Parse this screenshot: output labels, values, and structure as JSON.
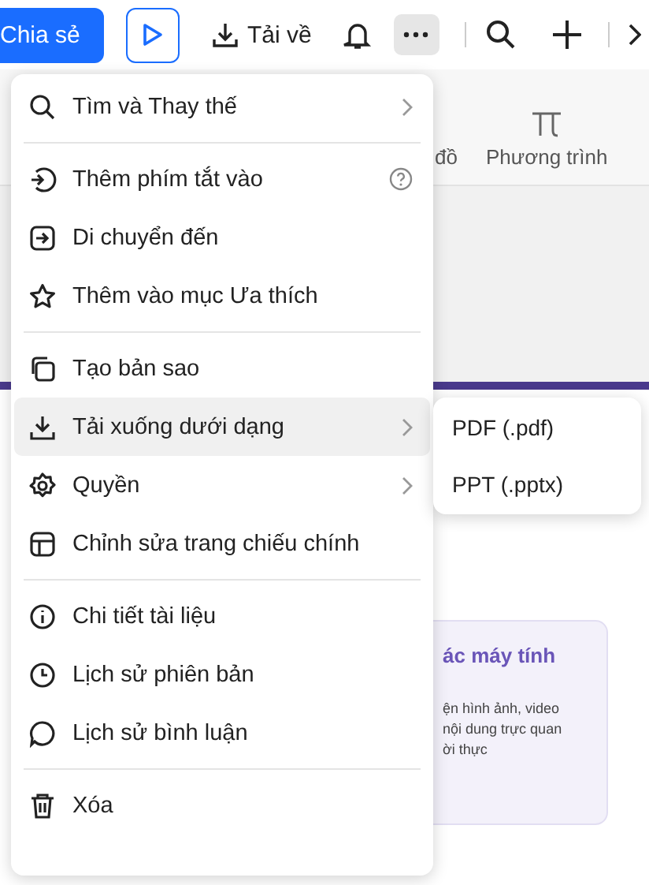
{
  "toolbar": {
    "share": "Chia sẻ",
    "download": "Tải về"
  },
  "ribbon": {
    "items": [
      "đồ",
      "Phương trình"
    ]
  },
  "slide_card": {
    "title": "ác máy tính",
    "lines": [
      "ện hình ảnh, video",
      "nội dung trực quan",
      "ời thực"
    ]
  },
  "menu": {
    "groups": [
      [
        {
          "label": "Tìm và Thay thế",
          "submenu": true,
          "help": false,
          "selected": false
        }
      ],
      [
        {
          "label": "Thêm phím tắt vào",
          "submenu": false,
          "help": true,
          "selected": false
        },
        {
          "label": "Di chuyển đến",
          "submenu": false,
          "help": false,
          "selected": false
        },
        {
          "label": "Thêm vào mục Ưa thích",
          "submenu": false,
          "help": false,
          "selected": false
        }
      ],
      [
        {
          "label": "Tạo bản sao",
          "submenu": false,
          "help": false,
          "selected": false
        },
        {
          "label": "Tải xuống dưới dạng",
          "submenu": true,
          "help": false,
          "selected": true
        },
        {
          "label": "Quyền",
          "submenu": true,
          "help": false,
          "selected": false
        },
        {
          "label": "Chỉnh sửa trang chiếu chính",
          "submenu": false,
          "help": false,
          "selected": false
        }
      ],
      [
        {
          "label": "Chi tiết tài liệu",
          "submenu": false,
          "help": false,
          "selected": false
        },
        {
          "label": "Lịch sử phiên bản",
          "submenu": false,
          "help": false,
          "selected": false
        },
        {
          "label": "Lịch sử bình luận",
          "submenu": false,
          "help": false,
          "selected": false
        }
      ],
      [
        {
          "label": "Xóa",
          "submenu": false,
          "help": false,
          "selected": false
        }
      ]
    ]
  },
  "submenu": {
    "items": [
      "PDF (.pdf)",
      "PPT (.pptx)"
    ]
  }
}
